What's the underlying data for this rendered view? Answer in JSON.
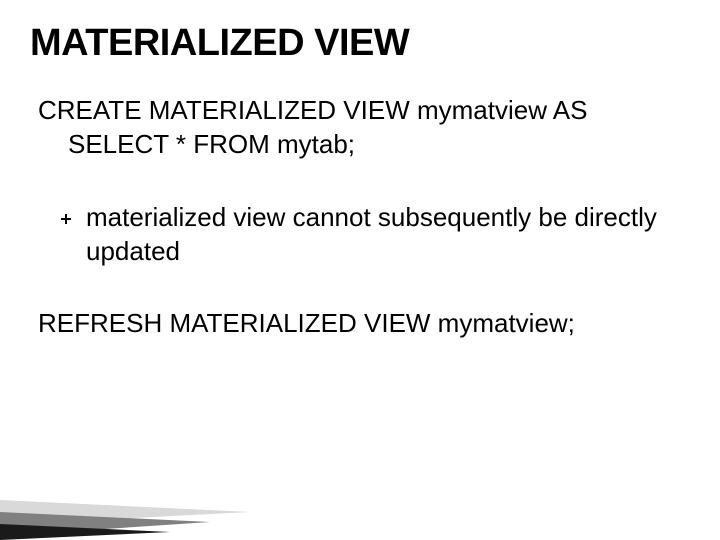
{
  "title": "MATERIALIZED VIEW",
  "code1": {
    "line1": "CREATE MATERIALIZED VIEW mymatview AS",
    "line2": "SELECT * FROM mytab;"
  },
  "bullet": {
    "text": "materialized view cannot subsequently be directly updated"
  },
  "code2": "REFRESH MATERIALIZED VIEW mymatview;"
}
